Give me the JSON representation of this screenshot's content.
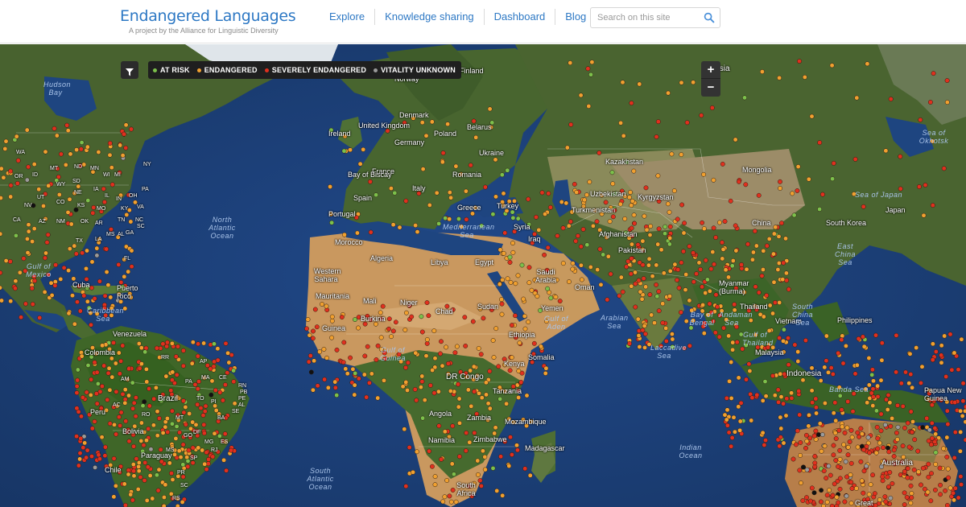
{
  "site": {
    "title": "Endangered Languages",
    "subtitle": "A project by the Alliance for Linguistic Diversity"
  },
  "nav": {
    "items": [
      {
        "label": "Explore",
        "name": "nav-explore"
      },
      {
        "label": "Knowledge sharing",
        "name": "nav-knowledge-sharing"
      },
      {
        "label": "Dashboard",
        "name": "nav-dashboard"
      },
      {
        "label": "Blog",
        "name": "nav-blog"
      }
    ]
  },
  "search": {
    "placeholder": "Search on this site",
    "icon": "search-icon"
  },
  "map": {
    "filter_icon": "filter-icon",
    "zoom": {
      "in_label": "+",
      "out_label": "−"
    },
    "legend": [
      {
        "label": "AT RISK",
        "color": "#7cc04b"
      },
      {
        "label": "ENDANGERED",
        "color": "#f0a030"
      },
      {
        "label": "SEVERELY ENDANGERED",
        "color": "#e0301e"
      },
      {
        "label": "VITALITY UNKNOWN",
        "color": "#9a9a9a"
      }
    ],
    "colors": {
      "ocean": "#1d3f78",
      "land": "#45602e",
      "desert": "#c89a62",
      "ice": "#dfe5ea"
    },
    "labels": {
      "russia": "Russia",
      "finland": "Finland",
      "norway": "Norway",
      "denmark": "Denmark",
      "uk": "United Kingdom",
      "ireland": "Ireland",
      "poland": "Poland",
      "belarus": "Belarus",
      "germany": "Germany",
      "ukraine": "Ukraine",
      "france": "France",
      "bay_biscay": "Bay of Biscay",
      "romania": "Romania",
      "italy": "Italy",
      "spain": "Spain",
      "portugal": "Portugal",
      "greece": "Greece",
      "turkey": "Turkey",
      "kazakhstan": "Kazakhstan",
      "mongolia": "Mongolia",
      "uzbekistan": "Uzbekistan",
      "kyrgyzstan": "Kyrgyzstan",
      "turkmenistan": "Turkmenistan",
      "afghanistan": "Afghanistan",
      "pakistan": "Pakistan",
      "iraq": "Iraq",
      "syria": "Syria",
      "china": "China",
      "south_korea": "South Korea",
      "japan": "Japan",
      "sea_japan": "Sea of Japan",
      "sea_okhotsk": "Sea of Okhotsk",
      "east_china_sea": "East China Sea",
      "morocco": "Morocco",
      "algeria": "Algeria",
      "libya": "Libya",
      "egypt": "Egypt",
      "western_sahara": "Western Sahara",
      "mauritania": "Mauritania",
      "mali": "Mali",
      "niger": "Niger",
      "chad": "Chad",
      "sudan": "Sudan",
      "saudi_arabia": "Saudi Arabia",
      "yemen": "Yemen",
      "oman": "Oman",
      "mediterranean": "Mediterranean Sea",
      "gulf_aden": "Gulf of Aden",
      "guinea": "Guinea",
      "burkina": "Burkina",
      "gulf_guinea": "Gulf of Guinea",
      "ethiopia": "Ethiopia",
      "somalia": "Somalia",
      "dr_congo": "DR Congo",
      "kenya": "Kenya",
      "tanzania": "Tanzania",
      "angola": "Angola",
      "zambia": "Zambia",
      "namibia": "Namibia",
      "zimbabwe": "Zimbabwe",
      "mozambique": "Mozambique",
      "madagascar": "Madagascar",
      "south_africa": "South Africa",
      "arabian_sea": "Arabian Sea",
      "bay_bengal": "Bay of Bengal",
      "andaman": "Andaman Sea",
      "myanmar": "Myanmar (Burma)",
      "thailand": "Thailand",
      "gulf_thailand": "Gulf of Thailand",
      "vietnam": "Vietnam",
      "south_china_sea": "South China Sea",
      "philippines": "Philippines",
      "malaysia": "Malaysia",
      "indonesia": "Indonesia",
      "banda_sea": "Banda Sea",
      "png": "Papua New Guinea",
      "laccadive": "Laccadive Sea",
      "australia": "Australia",
      "great": "Great",
      "hudson_bay": "Hudson Bay",
      "gulf_mexico": "Gulf of Mexico",
      "cuba": "Cuba",
      "puerto_rico": "Puerto Rico",
      "caribbean": "Caribbean Sea",
      "venezuela": "Venezuela",
      "colombia": "Colombia",
      "peru": "Peru",
      "brazil": "Brazil",
      "bolivia": "Bolivia",
      "paraguay": "Paraguay",
      "chile": "Chile",
      "north_atlantic": "North Atlantic Ocean",
      "south_atlantic": "South Atlantic Ocean",
      "indian_ocean": "Indian Ocean",
      "us_states": [
        "MT",
        "ND",
        "MN",
        "WI",
        "MI",
        "NY",
        "SD",
        "WY",
        "NE",
        "IA",
        "IL",
        "IN",
        "OH",
        "PA",
        "CO",
        "KS",
        "MO",
        "KY",
        "VA",
        "NM",
        "OK",
        "AR",
        "TN",
        "NC",
        "TX",
        "LA",
        "MS",
        "AL",
        "GA",
        "SC",
        "FL",
        "NV",
        "UT",
        "AZ",
        "CA",
        "OR",
        "ID",
        "WA"
      ],
      "br_states": [
        "RR",
        "AP",
        "AM",
        "PA",
        "MA",
        "CE",
        "RN",
        "PB",
        "PE",
        "AL",
        "SE",
        "TO",
        "PI",
        "BA",
        "MT",
        "RO",
        "AC",
        "GO",
        "DF",
        "MG",
        "ES",
        "MS",
        "SP",
        "RJ",
        "PR",
        "SC",
        "RS"
      ]
    }
  }
}
